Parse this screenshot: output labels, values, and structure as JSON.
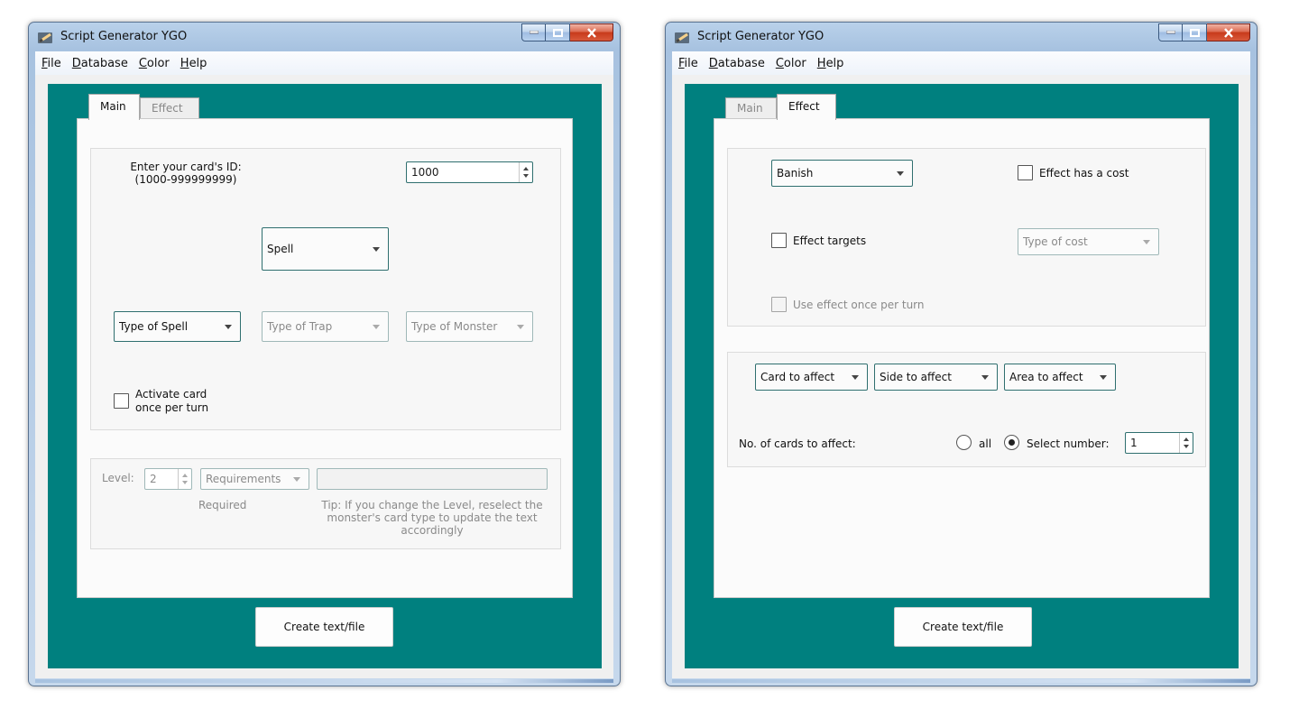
{
  "app": {
    "title": "Script Generator YGO",
    "menu": [
      {
        "mnemonic": "F",
        "rest": "ile"
      },
      {
        "mnemonic": "D",
        "rest": "atabase"
      },
      {
        "mnemonic": "C",
        "rest": "olor"
      },
      {
        "mnemonic": "H",
        "rest": "elp"
      }
    ],
    "create_button": "Create text/file",
    "colors": {
      "background": "#00807f"
    }
  },
  "tabs": {
    "main": "Main",
    "effect": "Effect"
  },
  "main_tab": {
    "id_label_line1": "Enter your card's ID:",
    "id_label_line2": "(1000-999999999)",
    "id_value": "1000",
    "card_category": "Spell",
    "type_of_spell": "Type of Spell",
    "type_of_trap": "Type of Trap",
    "type_of_monster": "Type of Monster",
    "activate_line1": "Activate card",
    "activate_line2": "once per turn",
    "level_label": "Level:",
    "level_value": "2",
    "requirements": "Requirements",
    "required_label": "Required",
    "tip_line1": "Tip: If you change the Level, reselect the",
    "tip_line2": "monster's card type to update the text",
    "tip_line3": "accordingly"
  },
  "effect_tab": {
    "effect": "Banish",
    "has_cost": "Effect has a cost",
    "targets": "Effect targets",
    "type_of_cost": "Type of cost",
    "once_per_turn": "Use effect once per turn",
    "card_to_affect": "Card to affect",
    "side_to_affect": "Side to affect",
    "area_to_affect": "Area to affect",
    "no_of_cards_label": "No. of cards to affect:",
    "option_all": "all",
    "option_select": "Select number:",
    "number_value": "1"
  }
}
